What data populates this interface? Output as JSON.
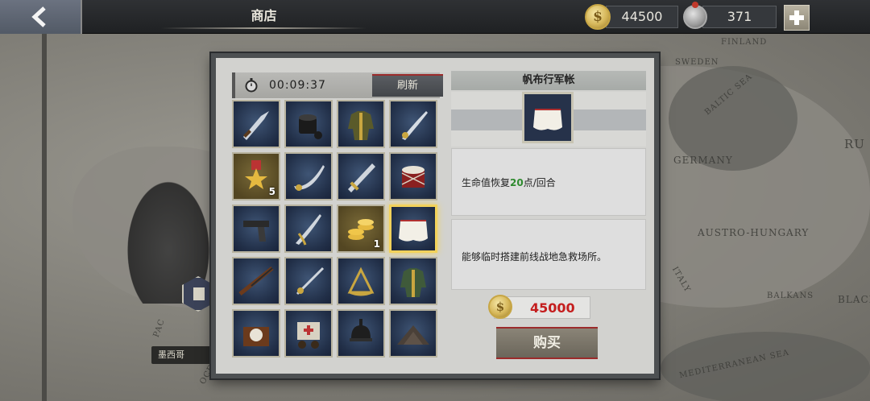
{
  "header": {
    "title": "商店",
    "gold": "44500",
    "medals": "371",
    "gold_symbol": "$"
  },
  "map": {
    "labels": [
      "SWEDEN",
      "FINLAND",
      "BALTIC SEA",
      "GERMANY",
      "RU",
      "AUSTRO-HUNGARY",
      "ITALY",
      "BALKANS",
      "BLACK",
      "MEDITERRANEAN SEA",
      "PAC",
      "OCEAN"
    ],
    "city": "墨西哥"
  },
  "shop": {
    "timer": "00:09:37",
    "refresh_label": "刷新",
    "items": [
      {
        "icon": "dagger-icon",
        "count": ""
      },
      {
        "icon": "cooking-pot-icon",
        "count": ""
      },
      {
        "icon": "military-uniform-icon",
        "count": ""
      },
      {
        "icon": "sabre-icon",
        "count": ""
      },
      {
        "icon": "medal-icon",
        "count": "5"
      },
      {
        "icon": "curved-sword-icon",
        "count": ""
      },
      {
        "icon": "broadsword-icon",
        "count": ""
      },
      {
        "icon": "drum-icon",
        "count": ""
      },
      {
        "icon": "pistol-icon",
        "count": ""
      },
      {
        "icon": "cavalry-sabre-icon",
        "count": ""
      },
      {
        "icon": "gold-coins-icon",
        "count": "1"
      },
      {
        "icon": "canvas-tent-icon",
        "count": ""
      },
      {
        "icon": "rifle-icon",
        "count": ""
      },
      {
        "icon": "rapier-icon",
        "count": ""
      },
      {
        "icon": "sextant-icon",
        "count": ""
      },
      {
        "icon": "officer-jacket-icon",
        "count": ""
      },
      {
        "icon": "pocket-watch-case-icon",
        "count": ""
      },
      {
        "icon": "medical-cart-icon",
        "count": ""
      },
      {
        "icon": "pickelhaube-helmet-icon",
        "count": ""
      },
      {
        "icon": "dirt-mound-icon",
        "count": ""
      }
    ]
  },
  "detail": {
    "item_name": "帆布行军帐",
    "effect_prefix": "生命值恢复",
    "effect_value": "20",
    "effect_suffix": "点/回合",
    "description": "能够临时搭建前线战地急救场所。",
    "price": "45000",
    "buy_label": "购买"
  }
}
